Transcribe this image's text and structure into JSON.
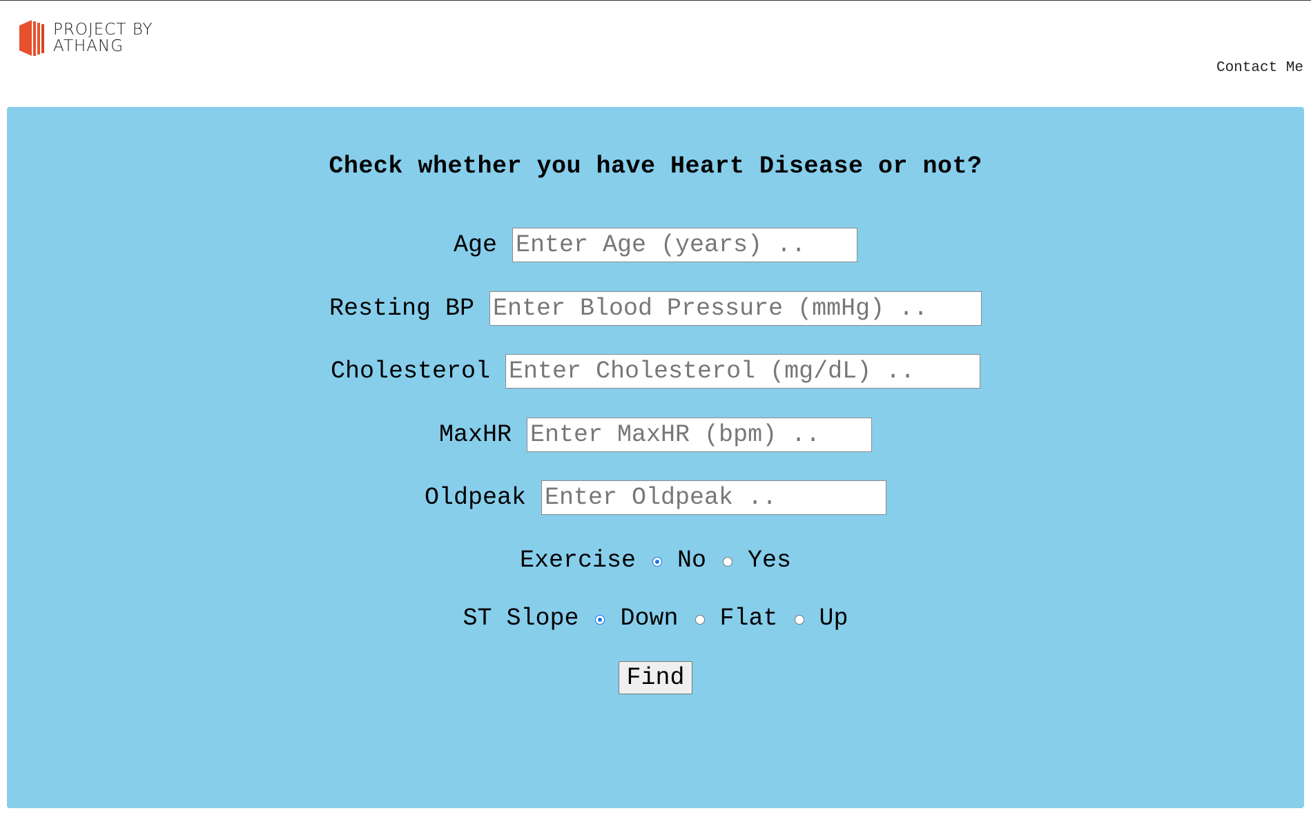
{
  "header": {
    "logo_line1": "PROJECT BY",
    "logo_line2": "ATHANG",
    "contact_label": "Contact Me"
  },
  "form": {
    "title": "Check whether you have Heart Disease or not?",
    "age": {
      "label": "Age",
      "placeholder": "Enter Age (years) .."
    },
    "resting_bp": {
      "label": "Resting BP",
      "placeholder": "Enter Blood Pressure (mmHg) .."
    },
    "cholesterol": {
      "label": "Cholesterol",
      "placeholder": "Enter Cholesterol (mg/dL) .."
    },
    "maxhr": {
      "label": "MaxHR",
      "placeholder": "Enter MaxHR (bpm) .."
    },
    "oldpeak": {
      "label": "Oldpeak",
      "placeholder": "Enter Oldpeak .."
    },
    "exercise": {
      "label": "Exercise",
      "options": [
        "No",
        "Yes"
      ],
      "selected": "No"
    },
    "st_slope": {
      "label": "ST Slope",
      "options": [
        "Down",
        "Flat",
        "Up"
      ],
      "selected": "Down"
    },
    "submit_label": "Find"
  },
  "colors": {
    "panel_background": "#87ceeb",
    "logo_accent": "#e8502e",
    "radio_checked": "#1a73e8"
  }
}
